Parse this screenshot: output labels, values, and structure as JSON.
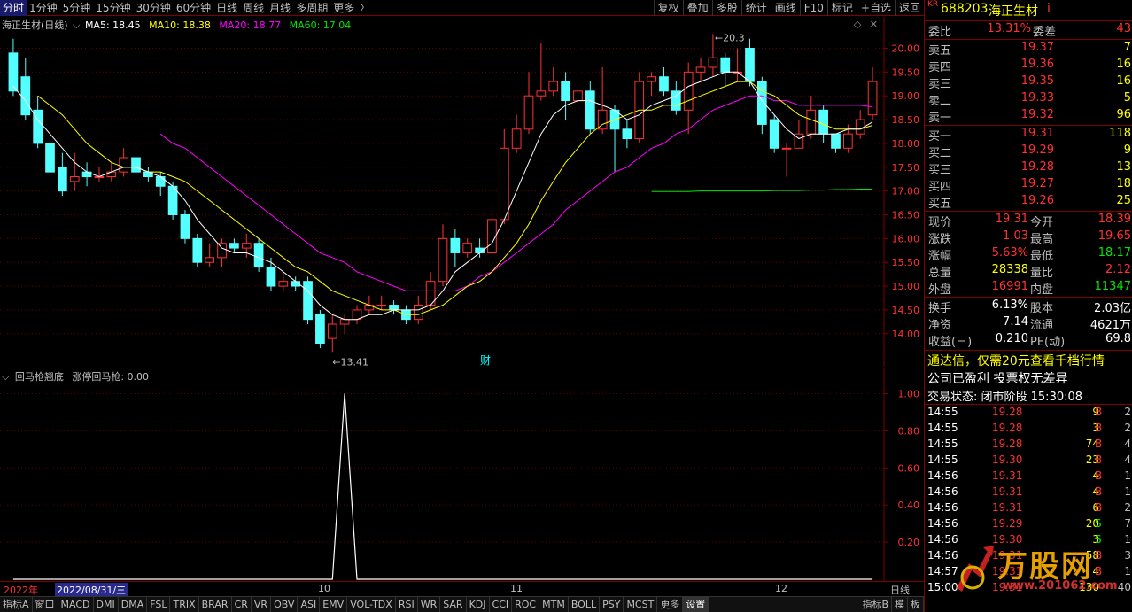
{
  "toolbar": {
    "periods": [
      "分时",
      "1分钟",
      "5分钟",
      "15分钟",
      "30分钟",
      "60分钟",
      "日线",
      "周线",
      "月线",
      "多周期",
      "更多"
    ],
    "buttons": [
      "复权",
      "叠加",
      "多股",
      "统计",
      "画线",
      "F10",
      "标记",
      "+自选",
      "返回"
    ]
  },
  "main_legend": {
    "stock": "海正生材(日线)",
    "ma5": "MA5: 18.45",
    "ma10": "MA10: 18.38",
    "ma20": "MA20: 18.77",
    "ma60": "MA60: 17.04"
  },
  "sub_legend": {
    "name": "回马枪翘底",
    "line": "涨停回马枪: 0.00"
  },
  "annotations": {
    "high": "20.3",
    "low": "13.41",
    "finance_marker": "财"
  },
  "date_axis": {
    "year": "2022年",
    "cursor_date": "2022/08/31/三",
    "months": [
      "10",
      "11",
      "12"
    ],
    "period": "日线"
  },
  "indicator_tabs": [
    "指标A",
    "窗口",
    "MACD",
    "DMI",
    "DMA",
    "FSL",
    "TRIX",
    "BRAR",
    "CR",
    "VR",
    "OBV",
    "ASI",
    "EMV",
    "VOL-TDX",
    "RSI",
    "WR",
    "SAR",
    "KDJ",
    "CCI",
    "ROC",
    "MTM",
    "BOLL",
    "PSY",
    "MCST",
    "更多",
    "设置"
  ],
  "indicator_tabs_right": [
    "指标B",
    "模",
    "板"
  ],
  "colors": {
    "up": "#ff3232",
    "down": "#54ffff",
    "ma5": "#ffffff",
    "ma10": "#ffff00",
    "ma20": "#ff00ff",
    "ma60": "#00e600",
    "grid": "#7f0000"
  },
  "chart_data": {
    "type": "candlestick",
    "title": "海正生材(日线)",
    "ylim": [
      13.4,
      20.4
    ],
    "y_ticks": [
      "14.00",
      "14.50",
      "15.00",
      "15.50",
      "16.00",
      "16.50",
      "17.00",
      "17.50",
      "18.00",
      "18.50",
      "19.00",
      "19.50",
      "20.00"
    ],
    "candles": [
      [
        19.9,
        19.1,
        20.2,
        19.0
      ],
      [
        19.4,
        18.6,
        19.8,
        18.5
      ],
      [
        18.7,
        18.0,
        19.0,
        17.9
      ],
      [
        18.0,
        17.4,
        18.2,
        17.3
      ],
      [
        17.5,
        17.0,
        17.8,
        16.9
      ],
      [
        17.2,
        17.3,
        17.8,
        17.0
      ],
      [
        17.4,
        17.3,
        17.6,
        17.1
      ],
      [
        17.3,
        17.3,
        17.5,
        17.2
      ],
      [
        17.3,
        17.4,
        17.6,
        17.2
      ],
      [
        17.4,
        17.7,
        17.9,
        17.3
      ],
      [
        17.7,
        17.4,
        17.8,
        17.3
      ],
      [
        17.4,
        17.3,
        17.5,
        17.2
      ],
      [
        17.3,
        17.1,
        17.4,
        16.9
      ],
      [
        17.1,
        16.5,
        17.2,
        16.4
      ],
      [
        16.5,
        16.0,
        16.6,
        15.9
      ],
      [
        16.0,
        15.5,
        16.1,
        15.4
      ],
      [
        15.5,
        15.6,
        15.9,
        15.4
      ],
      [
        15.6,
        15.9,
        16.0,
        15.4
      ],
      [
        15.9,
        15.8,
        16.0,
        15.7
      ],
      [
        15.8,
        15.9,
        16.1,
        15.6
      ],
      [
        15.9,
        15.4,
        16.0,
        15.3
      ],
      [
        15.4,
        15.0,
        15.6,
        14.9
      ],
      [
        15.0,
        15.1,
        15.3,
        14.9
      ],
      [
        15.1,
        15.0,
        15.2,
        14.9
      ],
      [
        15.1,
        14.3,
        15.2,
        14.2
      ],
      [
        14.4,
        13.8,
        14.5,
        13.7
      ],
      [
        13.9,
        14.2,
        14.4,
        13.6
      ],
      [
        14.2,
        14.3,
        14.4,
        14.0
      ],
      [
        14.3,
        14.5,
        14.6,
        14.2
      ],
      [
        14.5,
        14.6,
        14.8,
        14.4
      ],
      [
        14.6,
        14.6,
        14.8,
        14.5
      ],
      [
        14.6,
        14.5,
        14.7,
        14.4
      ],
      [
        14.5,
        14.3,
        14.6,
        14.2
      ],
      [
        14.3,
        14.6,
        14.8,
        14.2
      ],
      [
        14.6,
        15.1,
        15.3,
        14.5
      ],
      [
        15.1,
        16.0,
        16.3,
        15.0
      ],
      [
        16.0,
        15.7,
        16.2,
        15.4
      ],
      [
        15.7,
        15.9,
        16.0,
        15.6
      ],
      [
        15.8,
        15.7,
        16.0,
        15.6
      ],
      [
        15.7,
        16.4,
        16.7,
        15.6
      ],
      [
        16.4,
        17.9,
        18.3,
        16.3
      ],
      [
        17.9,
        18.3,
        18.6,
        17.8
      ],
      [
        18.3,
        19.0,
        19.5,
        18.2
      ],
      [
        19.0,
        19.1,
        20.1,
        18.9
      ],
      [
        19.1,
        19.3,
        19.6,
        19.0
      ],
      [
        19.3,
        18.9,
        19.5,
        18.5
      ],
      [
        18.9,
        19.1,
        19.4,
        18.8
      ],
      [
        19.1,
        18.3,
        19.3,
        18.2
      ],
      [
        18.3,
        18.7,
        19.6,
        18.2
      ],
      [
        18.7,
        18.3,
        18.8,
        17.4
      ],
      [
        18.3,
        18.1,
        18.5,
        17.9
      ],
      [
        18.1,
        19.3,
        19.5,
        18.0
      ],
      [
        19.3,
        19.4,
        19.5,
        19.0
      ],
      [
        19.4,
        19.1,
        19.6,
        19.0
      ],
      [
        19.1,
        18.7,
        19.3,
        18.6
      ],
      [
        18.7,
        19.5,
        19.7,
        18.2
      ],
      [
        19.5,
        19.6,
        19.8,
        19.3
      ],
      [
        19.6,
        19.8,
        20.3,
        19.4
      ],
      [
        19.8,
        19.5,
        19.9,
        19.2
      ],
      [
        19.5,
        19.5,
        20.0,
        19.3
      ],
      [
        20.0,
        19.3,
        20.2,
        19.2
      ],
      [
        19.3,
        18.4,
        19.4,
        18.2
      ],
      [
        18.5,
        17.9,
        18.6,
        17.8
      ],
      [
        17.9,
        17.9,
        18.0,
        17.3
      ],
      [
        17.9,
        18.2,
        18.5,
        17.9
      ],
      [
        18.2,
        18.7,
        19.0,
        18.1
      ],
      [
        18.7,
        18.2,
        18.8,
        18.0
      ],
      [
        18.2,
        17.9,
        18.2,
        17.8
      ],
      [
        17.9,
        18.2,
        18.4,
        17.8
      ],
      [
        18.2,
        18.5,
        18.7,
        18.1
      ],
      [
        18.6,
        19.3,
        19.6,
        18.5
      ]
    ],
    "ma5": [
      19.2,
      18.9,
      18.5,
      18.2,
      17.9,
      17.6,
      17.4,
      17.3,
      17.4,
      17.5,
      17.5,
      17.4,
      17.3,
      17.1,
      16.8,
      16.4,
      16.1,
      15.8,
      15.7,
      15.7,
      15.6,
      15.5,
      15.3,
      15.1,
      14.9,
      14.6,
      14.4,
      14.3,
      14.3,
      14.4,
      14.4,
      14.5,
      14.5,
      14.5,
      14.6,
      14.9,
      15.3,
      15.5,
      15.7,
      15.9,
      16.4,
      17.0,
      17.6,
      18.2,
      18.6,
      18.8,
      18.9,
      18.9,
      18.8,
      18.7,
      18.5,
      18.6,
      18.8,
      18.9,
      19.0,
      19.2,
      19.3,
      19.4,
      19.5,
      19.5,
      19.3,
      18.9,
      18.6,
      18.3,
      18.1,
      18.2,
      18.2,
      18.2,
      18.3,
      18.3,
      18.45
    ],
    "ma10": [
      null,
      null,
      19.0,
      18.8,
      18.6,
      18.3,
      18.0,
      17.8,
      17.6,
      17.5,
      17.5,
      17.4,
      17.4,
      17.3,
      17.2,
      17.0,
      16.8,
      16.6,
      16.4,
      16.2,
      16.0,
      15.8,
      15.6,
      15.4,
      15.3,
      15.1,
      14.9,
      14.8,
      14.7,
      14.6,
      14.5,
      14.5,
      14.4,
      14.4,
      14.5,
      14.6,
      14.8,
      15.0,
      15.1,
      15.3,
      15.6,
      15.9,
      16.3,
      16.8,
      17.2,
      17.6,
      17.9,
      18.2,
      18.4,
      18.5,
      18.6,
      18.7,
      18.7,
      18.8,
      18.8,
      18.9,
      19.0,
      19.1,
      19.2,
      19.3,
      19.3,
      19.1,
      19.0,
      18.8,
      18.6,
      18.5,
      18.4,
      18.3,
      18.3,
      18.3,
      18.38
    ],
    "ma20": [
      null,
      null,
      null,
      null,
      null,
      null,
      null,
      null,
      null,
      null,
      null,
      null,
      18.2,
      18.0,
      17.9,
      17.7,
      17.5,
      17.3,
      17.1,
      16.9,
      16.7,
      16.5,
      16.3,
      16.1,
      15.9,
      15.7,
      15.6,
      15.5,
      15.3,
      15.2,
      15.1,
      15.0,
      14.9,
      14.9,
      14.9,
      14.9,
      14.9,
      15.0,
      15.2,
      15.3,
      15.5,
      15.7,
      15.9,
      16.1,
      16.3,
      16.6,
      16.8,
      17.0,
      17.2,
      17.4,
      17.5,
      17.7,
      17.9,
      18.0,
      18.2,
      18.3,
      18.5,
      18.7,
      18.8,
      18.9,
      19.0,
      19.0,
      18.9,
      18.9,
      18.8,
      18.8,
      18.8,
      18.8,
      18.8,
      18.8,
      18.77
    ],
    "ma60": [
      null,
      null,
      null,
      null,
      null,
      null,
      null,
      null,
      null,
      null,
      null,
      null,
      null,
      null,
      null,
      null,
      null,
      null,
      null,
      null,
      null,
      null,
      null,
      null,
      null,
      null,
      null,
      null,
      null,
      null,
      null,
      null,
      null,
      null,
      null,
      null,
      null,
      null,
      null,
      null,
      null,
      null,
      null,
      null,
      null,
      null,
      null,
      null,
      null,
      null,
      null,
      null,
      16.99,
      16.99,
      16.99,
      16.99,
      17.0,
      17.0,
      17.0,
      17.0,
      17.0,
      17.0,
      17.01,
      17.01,
      17.01,
      17.02,
      17.02,
      17.03,
      17.03,
      17.04,
      17.04
    ],
    "sub_ylim": [
      0,
      1.05
    ],
    "sub_ticks": [
      "1.00",
      "0.80",
      "0.60",
      "0.40",
      "0.20"
    ],
    "signal": [
      0,
      0,
      0,
      0,
      0,
      0,
      0,
      0,
      0,
      0,
      0,
      0,
      0,
      0,
      0,
      0,
      0,
      0,
      0,
      0,
      0,
      0,
      0,
      0,
      0,
      0,
      0,
      1,
      0,
      0,
      0,
      0,
      0,
      0,
      0,
      0,
      0,
      0,
      0,
      0,
      0,
      0,
      0,
      0,
      0,
      0,
      0,
      0,
      0,
      0,
      0,
      0,
      0,
      0,
      0,
      0,
      0,
      0,
      0,
      0,
      0,
      0,
      0,
      0,
      0,
      0,
      0,
      0,
      0,
      0,
      0
    ]
  },
  "quote": {
    "code": "688203",
    "name": "海正生材",
    "badge": "KR",
    "info_icon": "i",
    "weibi_label": "委比",
    "weibi": "13.31%",
    "weicha_label": "委差",
    "weicha": "43",
    "asks": [
      {
        "label": "卖五",
        "price": "19.37",
        "vol": "7"
      },
      {
        "label": "卖四",
        "price": "19.36",
        "vol": "16"
      },
      {
        "label": "卖三",
        "price": "19.35",
        "vol": "16"
      },
      {
        "label": "卖二",
        "price": "19.33",
        "vol": "5"
      },
      {
        "label": "卖一",
        "price": "19.32",
        "vol": "96"
      }
    ],
    "bids": [
      {
        "label": "买一",
        "price": "19.31",
        "vol": "118"
      },
      {
        "label": "买二",
        "price": "19.29",
        "vol": "9"
      },
      {
        "label": "买三",
        "price": "19.28",
        "vol": "13"
      },
      {
        "label": "买四",
        "price": "19.27",
        "vol": "18"
      },
      {
        "label": "买五",
        "price": "19.26",
        "vol": "25"
      }
    ],
    "stats": [
      {
        "l1": "现价",
        "v1": "19.31",
        "c1": "red",
        "l2": "今开",
        "v2": "18.39",
        "c2": "red"
      },
      {
        "l1": "涨跌",
        "v1": "1.03",
        "c1": "red",
        "l2": "最高",
        "v2": "19.65",
        "c2": "red"
      },
      {
        "l1": "涨幅",
        "v1": "5.63%",
        "c1": "red",
        "l2": "最低",
        "v2": "18.17",
        "c2": "green"
      },
      {
        "l1": "总量",
        "v1": "28338",
        "c1": "yellow",
        "l2": "量比",
        "v2": "2.12",
        "c2": "red"
      },
      {
        "l1": "外盘",
        "v1": "16991",
        "c1": "red",
        "l2": "内盘",
        "v2": "11347",
        "c2": "green"
      }
    ],
    "stats2": [
      {
        "l1": "换手",
        "v1": "6.13%",
        "l2": "股本",
        "v2": "2.03亿"
      },
      {
        "l1": "净资",
        "v1": "7.14",
        "l2": "流通",
        "v2": "4621万"
      },
      {
        "l1": "收益(三)",
        "v1": "0.210",
        "l2": "PE(动)",
        "v2": "69.8"
      }
    ],
    "ad": "通达信，仅需20元查看千档行情",
    "company_note": "公司已盈利 投票权无差异",
    "trade_status": "交易状态: 闭市阶段 15:30:08",
    "ticks": [
      {
        "time": "14:55",
        "price": "19.28",
        "vol": "9",
        "bs": "B",
        "n": "2"
      },
      {
        "time": "14:55",
        "price": "19.28",
        "vol": "3",
        "bs": "B",
        "n": "2"
      },
      {
        "time": "14:55",
        "price": "19.28",
        "vol": "74",
        "bs": "B",
        "n": "4"
      },
      {
        "time": "14:55",
        "price": "19.30",
        "vol": "23",
        "bs": "B",
        "n": "4"
      },
      {
        "time": "14:56",
        "price": "19.31",
        "vol": "4",
        "bs": "B",
        "n": "1"
      },
      {
        "time": "14:56",
        "price": "19.31",
        "vol": "4",
        "bs": "B",
        "n": "1"
      },
      {
        "time": "14:56",
        "price": "19.31",
        "vol": "6",
        "bs": "B",
        "n": "2"
      },
      {
        "time": "14:56",
        "price": "19.29",
        "vol": "20",
        "bs": "S",
        "n": "7"
      },
      {
        "time": "14:56",
        "price": "19.30",
        "vol": "3",
        "bs": "S",
        "n": "1"
      },
      {
        "time": "14:56",
        "price": "19.31",
        "vol": "58",
        "bs": "B",
        "n": "3"
      },
      {
        "time": "14:57",
        "price": "19.31",
        "vol": "4",
        "bs": "B",
        "n": "1"
      },
      {
        "time": "15:00",
        "price": "19.31",
        "vol": "130",
        "bs": "",
        "n": "40"
      }
    ],
    "watermark": "万股网",
    "watermark_url": "www.201062.com"
  }
}
